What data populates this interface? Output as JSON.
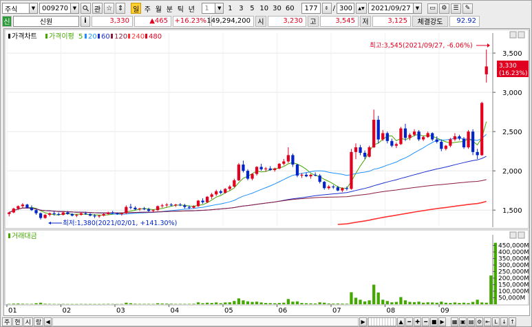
{
  "toolbar": {
    "market_select": "주식",
    "code_input": "009270",
    "search_icon": "magnifier-icon",
    "btn_gwan": "관",
    "btn_up": "☆",
    "period_label": "일",
    "period_week": "주",
    "period_month": "월",
    "period_minute": "분",
    "period_tick": "틱",
    "period_year": "년",
    "minute_select": "1",
    "minute_options": [
      "1",
      "3",
      "5",
      "10",
      "30",
      "60"
    ],
    "count_value": "177",
    "count_sep": "/",
    "count_total": "300",
    "date_value": "2021/09/27"
  },
  "quote": {
    "tag": "신",
    "name": "신원",
    "info_btn": "i",
    "price": "3,330",
    "change": "▲465",
    "change_pct": "+16.23%",
    "volume": "149,294,200",
    "open_label": "시",
    "open": "3,230",
    "high_label": "고",
    "high": "3,545",
    "low_label": "저",
    "low": "3,125",
    "strength_label": "체결강도",
    "strength": "92.92"
  },
  "colors": {
    "up": "#e1001f",
    "down": "#0024c8",
    "ma5": "#43a800",
    "ma20": "#1e90ff",
    "ma60": "#1a2ed0",
    "ma120": "#8b1a3a",
    "ma240": "#ff3030"
  },
  "price_panel": {
    "legend_title": "가격차트",
    "legend_ma_label": "가격이평",
    "legend_ma": [
      "5",
      "20",
      "60",
      "120",
      "240",
      "480"
    ],
    "max_annotation": "최고:3,545(2021/09/27, -6.06%)",
    "min_annotation": "최저:1,380(2021/02/01, +141.30%)",
    "current_price_label": "3,330",
    "current_pct_label": "(16.23%)"
  },
  "volume_panel": {
    "legend_title": "거래대금"
  },
  "chart_data": [
    {
      "type": "candlestick",
      "title": "가격차트",
      "y_ticks": [
        "1,500",
        "2,000",
        "2,500",
        "3,000",
        "3,500"
      ],
      "ylim": [
        1300,
        3650
      ],
      "x_ticks": [
        "01",
        "02",
        "03",
        "04",
        "05",
        "06",
        "07",
        "08",
        "09"
      ],
      "candles": [
        {
          "o": 1450,
          "h": 1480,
          "l": 1420,
          "c": 1470
        },
        {
          "o": 1470,
          "h": 1530,
          "l": 1460,
          "c": 1520
        },
        {
          "o": 1520,
          "h": 1560,
          "l": 1500,
          "c": 1550
        },
        {
          "o": 1550,
          "h": 1590,
          "l": 1530,
          "c": 1570
        },
        {
          "o": 1570,
          "h": 1580,
          "l": 1520,
          "c": 1530
        },
        {
          "o": 1530,
          "h": 1560,
          "l": 1490,
          "c": 1500
        },
        {
          "o": 1500,
          "h": 1520,
          "l": 1440,
          "c": 1460
        },
        {
          "o": 1460,
          "h": 1470,
          "l": 1380,
          "c": 1400
        },
        {
          "o": 1400,
          "h": 1450,
          "l": 1390,
          "c": 1440
        },
        {
          "o": 1440,
          "h": 1470,
          "l": 1420,
          "c": 1460
        },
        {
          "o": 1460,
          "h": 1480,
          "l": 1430,
          "c": 1450
        },
        {
          "o": 1450,
          "h": 1470,
          "l": 1430,
          "c": 1440
        },
        {
          "o": 1440,
          "h": 1480,
          "l": 1430,
          "c": 1470
        },
        {
          "o": 1470,
          "h": 1490,
          "l": 1440,
          "c": 1450
        },
        {
          "o": 1450,
          "h": 1460,
          "l": 1420,
          "c": 1430
        },
        {
          "o": 1430,
          "h": 1450,
          "l": 1410,
          "c": 1440
        },
        {
          "o": 1440,
          "h": 1470,
          "l": 1430,
          "c": 1460
        },
        {
          "o": 1460,
          "h": 1480,
          "l": 1440,
          "c": 1450
        },
        {
          "o": 1450,
          "h": 1460,
          "l": 1420,
          "c": 1430
        },
        {
          "o": 1430,
          "h": 1450,
          "l": 1400,
          "c": 1420
        },
        {
          "o": 1420,
          "h": 1440,
          "l": 1400,
          "c": 1430
        },
        {
          "o": 1430,
          "h": 1460,
          "l": 1420,
          "c": 1450
        },
        {
          "o": 1450,
          "h": 1480,
          "l": 1440,
          "c": 1470
        },
        {
          "o": 1470,
          "h": 1490,
          "l": 1450,
          "c": 1460
        },
        {
          "o": 1460,
          "h": 1470,
          "l": 1440,
          "c": 1450
        },
        {
          "o": 1450,
          "h": 1470,
          "l": 1430,
          "c": 1460
        },
        {
          "o": 1460,
          "h": 1560,
          "l": 1450,
          "c": 1540
        },
        {
          "o": 1540,
          "h": 1580,
          "l": 1510,
          "c": 1530
        },
        {
          "o": 1530,
          "h": 1550,
          "l": 1500,
          "c": 1510
        },
        {
          "o": 1510,
          "h": 1530,
          "l": 1490,
          "c": 1520
        },
        {
          "o": 1520,
          "h": 1540,
          "l": 1500,
          "c": 1510
        },
        {
          "o": 1510,
          "h": 1530,
          "l": 1480,
          "c": 1490
        },
        {
          "o": 1490,
          "h": 1510,
          "l": 1470,
          "c": 1500
        },
        {
          "o": 1500,
          "h": 1560,
          "l": 1490,
          "c": 1550
        },
        {
          "o": 1550,
          "h": 1580,
          "l": 1530,
          "c": 1560
        },
        {
          "o": 1560,
          "h": 1590,
          "l": 1540,
          "c": 1570
        },
        {
          "o": 1570,
          "h": 1590,
          "l": 1550,
          "c": 1560
        },
        {
          "o": 1560,
          "h": 1580,
          "l": 1540,
          "c": 1570
        },
        {
          "o": 1570,
          "h": 1590,
          "l": 1550,
          "c": 1560
        },
        {
          "o": 1560,
          "h": 1580,
          "l": 1520,
          "c": 1540
        },
        {
          "o": 1540,
          "h": 1560,
          "l": 1510,
          "c": 1530
        },
        {
          "o": 1530,
          "h": 1560,
          "l": 1520,
          "c": 1550
        },
        {
          "o": 1550,
          "h": 1630,
          "l": 1540,
          "c": 1620
        },
        {
          "o": 1620,
          "h": 1650,
          "l": 1580,
          "c": 1600
        },
        {
          "o": 1600,
          "h": 1680,
          "l": 1590,
          "c": 1670
        },
        {
          "o": 1670,
          "h": 1720,
          "l": 1640,
          "c": 1700
        },
        {
          "o": 1700,
          "h": 1760,
          "l": 1680,
          "c": 1740
        },
        {
          "o": 1740,
          "h": 1760,
          "l": 1700,
          "c": 1720
        },
        {
          "o": 1720,
          "h": 1780,
          "l": 1710,
          "c": 1770
        },
        {
          "o": 1770,
          "h": 1820,
          "l": 1750,
          "c": 1800
        },
        {
          "o": 1800,
          "h": 1900,
          "l": 1790,
          "c": 1880
        },
        {
          "o": 1880,
          "h": 2100,
          "l": 1870,
          "c": 2080
        },
        {
          "o": 2080,
          "h": 2130,
          "l": 1980,
          "c": 2000
        },
        {
          "o": 2000,
          "h": 2020,
          "l": 1880,
          "c": 1900
        },
        {
          "o": 1900,
          "h": 1970,
          "l": 1880,
          "c": 1960
        },
        {
          "o": 1960,
          "h": 2060,
          "l": 1940,
          "c": 2050
        },
        {
          "o": 2050,
          "h": 2090,
          "l": 2000,
          "c": 2020
        },
        {
          "o": 2020,
          "h": 2050,
          "l": 1990,
          "c": 2030
        },
        {
          "o": 2030,
          "h": 2060,
          "l": 2000,
          "c": 2010
        },
        {
          "o": 2010,
          "h": 2040,
          "l": 1990,
          "c": 2030
        },
        {
          "o": 2030,
          "h": 2100,
          "l": 2020,
          "c": 2090
        },
        {
          "o": 2090,
          "h": 2150,
          "l": 2070,
          "c": 2120
        },
        {
          "o": 2120,
          "h": 2300,
          "l": 2100,
          "c": 2200
        },
        {
          "o": 2200,
          "h": 2220,
          "l": 2050,
          "c": 2080
        },
        {
          "o": 2080,
          "h": 2090,
          "l": 1920,
          "c": 1940
        },
        {
          "o": 1940,
          "h": 1970,
          "l": 1910,
          "c": 1950
        },
        {
          "o": 1950,
          "h": 1980,
          "l": 1920,
          "c": 1930
        },
        {
          "o": 1930,
          "h": 1960,
          "l": 1900,
          "c": 1950
        },
        {
          "o": 1950,
          "h": 1980,
          "l": 1930,
          "c": 1940
        },
        {
          "o": 1940,
          "h": 1960,
          "l": 1840,
          "c": 1860
        },
        {
          "o": 1860,
          "h": 1870,
          "l": 1760,
          "c": 1780
        },
        {
          "o": 1780,
          "h": 1820,
          "l": 1760,
          "c": 1800
        },
        {
          "o": 1800,
          "h": 1820,
          "l": 1770,
          "c": 1790
        },
        {
          "o": 1790,
          "h": 1810,
          "l": 1740,
          "c": 1750
        },
        {
          "o": 1750,
          "h": 1790,
          "l": 1730,
          "c": 1780
        },
        {
          "o": 1780,
          "h": 1800,
          "l": 1750,
          "c": 1770
        },
        {
          "o": 1770,
          "h": 2280,
          "l": 1760,
          "c": 2240
        },
        {
          "o": 2240,
          "h": 2350,
          "l": 2150,
          "c": 2300
        },
        {
          "o": 2300,
          "h": 2330,
          "l": 2200,
          "c": 2230
        },
        {
          "o": 2230,
          "h": 2260,
          "l": 2150,
          "c": 2180
        },
        {
          "o": 2180,
          "h": 2320,
          "l": 2170,
          "c": 2300
        },
        {
          "o": 2300,
          "h": 2780,
          "l": 2290,
          "c": 2650
        },
        {
          "o": 2650,
          "h": 2700,
          "l": 2350,
          "c": 2400
        },
        {
          "o": 2400,
          "h": 2520,
          "l": 2380,
          "c": 2480
        },
        {
          "o": 2480,
          "h": 2500,
          "l": 2350,
          "c": 2380
        },
        {
          "o": 2380,
          "h": 2410,
          "l": 2300,
          "c": 2320
        },
        {
          "o": 2320,
          "h": 2360,
          "l": 2290,
          "c": 2340
        },
        {
          "o": 2340,
          "h": 2560,
          "l": 2330,
          "c": 2540
        },
        {
          "o": 2540,
          "h": 2600,
          "l": 2380,
          "c": 2420
        },
        {
          "o": 2420,
          "h": 2480,
          "l": 2390,
          "c": 2460
        },
        {
          "o": 2460,
          "h": 2530,
          "l": 2440,
          "c": 2500
        },
        {
          "o": 2500,
          "h": 2520,
          "l": 2380,
          "c": 2400
        },
        {
          "o": 2400,
          "h": 2450,
          "l": 2380,
          "c": 2430
        },
        {
          "o": 2430,
          "h": 2500,
          "l": 2420,
          "c": 2480
        },
        {
          "o": 2480,
          "h": 2490,
          "l": 2380,
          "c": 2400
        },
        {
          "o": 2400,
          "h": 2440,
          "l": 2350,
          "c": 2370
        },
        {
          "o": 2370,
          "h": 2400,
          "l": 2250,
          "c": 2280
        },
        {
          "o": 2280,
          "h": 2330,
          "l": 2260,
          "c": 2320
        },
        {
          "o": 2320,
          "h": 2420,
          "l": 2300,
          "c": 2400
        },
        {
          "o": 2400,
          "h": 2480,
          "l": 2380,
          "c": 2440
        },
        {
          "o": 2440,
          "h": 2460,
          "l": 2390,
          "c": 2410
        },
        {
          "o": 2410,
          "h": 2430,
          "l": 2280,
          "c": 2300
        },
        {
          "o": 2300,
          "h": 2520,
          "l": 2280,
          "c": 2500
        },
        {
          "o": 2500,
          "h": 2530,
          "l": 2200,
          "c": 2240
        },
        {
          "o": 2240,
          "h": 2280,
          "l": 2150,
          "c": 2200
        },
        {
          "o": 2200,
          "h": 2880,
          "l": 2190,
          "c": 2865
        },
        {
          "o": 3230,
          "h": 3545,
          "l": 3125,
          "c": 3330
        }
      ]
    },
    {
      "type": "bar",
      "title": "거래대금",
      "y_ticks": [
        "50,000M",
        "100,000M",
        "150,000M",
        "200,000M",
        "250,000M",
        "300,000M",
        "350,000M",
        "400,000M",
        "450,000M"
      ],
      "ylim": [
        0,
        500000
      ],
      "units": "M",
      "values": [
        3000,
        5000,
        6000,
        4000,
        3000,
        3000,
        8000,
        12000,
        4000,
        3000,
        2500,
        2000,
        2500,
        2000,
        2000,
        2000,
        2500,
        2000,
        2000,
        2000,
        2000,
        2500,
        3000,
        2500,
        2000,
        2000,
        12000,
        8000,
        4000,
        3000,
        3000,
        3000,
        2500,
        8000,
        6000,
        5000,
        4000,
        3000,
        3000,
        3000,
        3000,
        4000,
        15000,
        8000,
        12000,
        10000,
        14000,
        8000,
        14000,
        15000,
        25000,
        45000,
        30000,
        22000,
        18000,
        20000,
        14000,
        10000,
        9000,
        8000,
        10000,
        12000,
        40000,
        20000,
        22000,
        10000,
        8000,
        7000,
        6000,
        15000,
        12000,
        6000,
        5000,
        6000,
        5000,
        4000,
        92000,
        50000,
        35000,
        22000,
        30000,
        150000,
        90000,
        35000,
        25000,
        15000,
        18000,
        55000,
        30000,
        18000,
        16000,
        20000,
        12000,
        15000,
        14000,
        12000,
        20000,
        12000,
        10000,
        14000,
        10000,
        12000,
        9000,
        18000,
        35000,
        14000,
        12000,
        220000,
        470000
      ]
    }
  ],
  "bottombar": {
    "tabs": [
      "주",
      "현",
      "시",
      "랑"
    ],
    "icons": [
      "left-arrow-icon",
      "zoom-slider-icon",
      "zoom-out-icon",
      "zoom-in-icon",
      "move-icon",
      "stop-icon",
      "play-icon",
      "grid-icon",
      "image-icon",
      "image2-icon",
      "settings-icon",
      "skip-left-icon",
      "font-icon",
      "arrow-down-icon",
      "arrow-up-icon"
    ]
  }
}
